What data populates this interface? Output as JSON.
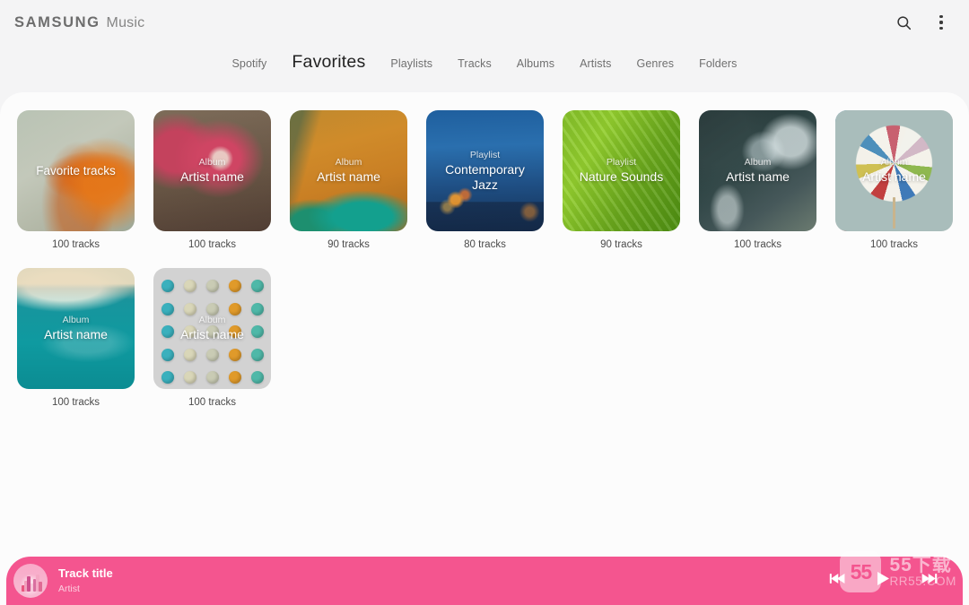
{
  "header": {
    "brand_samsung": "SAMSUNG",
    "brand_app": "Music",
    "search_icon": "search-icon",
    "overflow_icon": "more-vertical-icon"
  },
  "tabs": [
    {
      "label": "Spotify",
      "active": false
    },
    {
      "label": "Favorites",
      "active": true
    },
    {
      "label": "Playlists",
      "active": false
    },
    {
      "label": "Tracks",
      "active": false
    },
    {
      "label": "Albums",
      "active": false
    },
    {
      "label": "Artists",
      "active": false
    },
    {
      "label": "Genres",
      "active": false
    },
    {
      "label": "Folders",
      "active": false
    }
  ],
  "grid": {
    "cards": [
      {
        "kicker": "",
        "title": "Favorite tracks",
        "count": "100 tracks",
        "art": "tx1"
      },
      {
        "kicker": "Album",
        "title": "Artist name",
        "count": "100 tracks",
        "art": "tx2"
      },
      {
        "kicker": "Album",
        "title": "Artist name",
        "count": "90 tracks",
        "art": "tx3"
      },
      {
        "kicker": "Playlist",
        "title": "Contemporary Jazz",
        "count": "80 tracks",
        "art": "tx4"
      },
      {
        "kicker": "Playlist",
        "title": "Nature Sounds",
        "count": "90 tracks",
        "art": "tx5"
      },
      {
        "kicker": "Album",
        "title": "Artist name",
        "count": "100 tracks",
        "art": "tx6"
      },
      {
        "kicker": "Album",
        "title": "Artist name",
        "count": "100 tracks",
        "art": "tx7"
      },
      {
        "kicker": "Album",
        "title": "Artist name",
        "count": "100 tracks",
        "art": "tx8"
      },
      {
        "kicker": "Album",
        "title": "Artist name",
        "count": "100 tracks",
        "art": "tx9"
      }
    ]
  },
  "player": {
    "track_title": "Track title",
    "artist": "Artist",
    "prev_icon": "skip-previous-icon",
    "play_icon": "play-icon",
    "next_icon": "skip-next-icon",
    "bar_color": "#f4558f"
  },
  "watermark": {
    "logo": "55",
    "chinese": "55下载",
    "url": "RR55.COM"
  },
  "colors": {
    "header_bg": "#f4f4f5",
    "sheet_bg": "#fcfcfc",
    "accent": "#f4558f"
  }
}
